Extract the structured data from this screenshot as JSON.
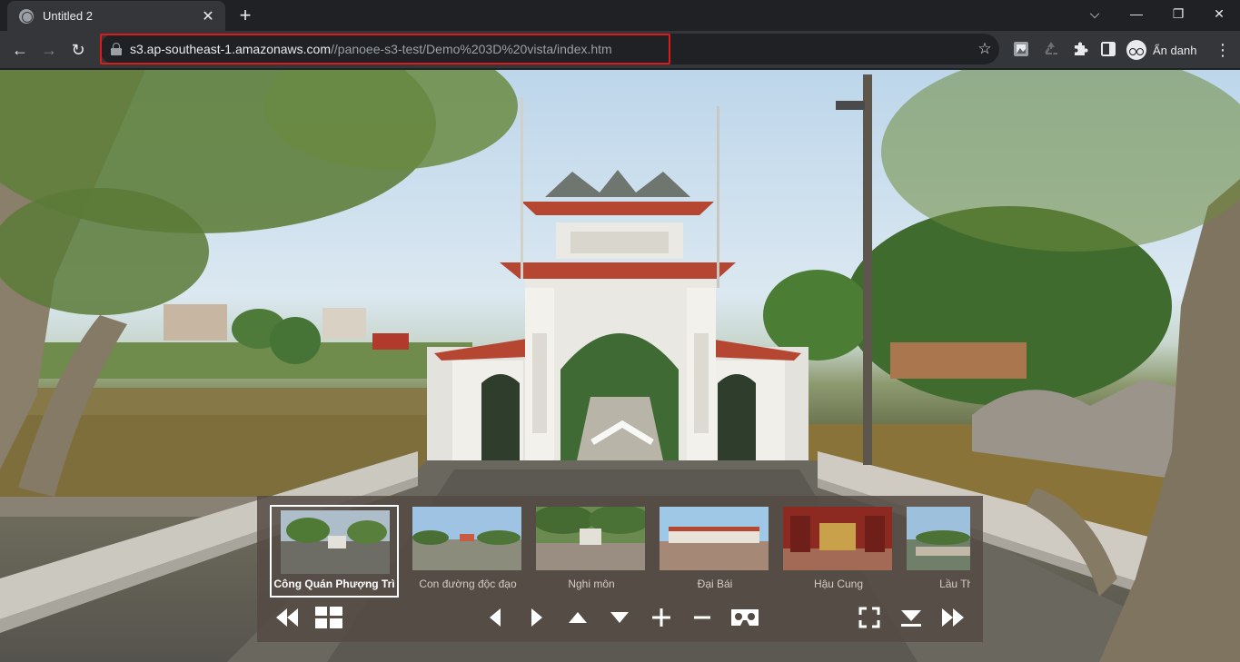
{
  "browser": {
    "tab_title": "Untitled 2",
    "tab_close_symbol": "✕",
    "new_tab_symbol": "+",
    "window_controls": {
      "collapse": "⌵",
      "minimize": "—",
      "restore": "❐",
      "close": "✕"
    },
    "nav": {
      "back": "←",
      "forward": "→",
      "reload": "↻"
    },
    "url_host": "s3.ap-southeast-1.amazonaws.com",
    "url_path": "//panoee-s3-test/Demo%203D%20vista/index.htm",
    "bookmark_star": "☆",
    "profile_label": "Ẩn danh",
    "menu_symbol": "⋮",
    "accent_highlight": "#e0191b"
  },
  "tour": {
    "scenes": [
      {
        "label": "Công Quán Phượng Trì",
        "active": true
      },
      {
        "label": "Con đường độc đạo",
        "active": false
      },
      {
        "label": "Nghi môn",
        "active": false
      },
      {
        "label": "Đại Bái",
        "active": false
      },
      {
        "label": "Hậu Cung",
        "active": false
      },
      {
        "label": "Lầu Thuỷ",
        "active": false
      }
    ],
    "controls": [
      "rewind",
      "grid",
      "pan-left",
      "pan-right",
      "pan-up",
      "pan-down",
      "zoom-in",
      "zoom-out",
      "vr",
      "fullscreen",
      "hide-panel",
      "fast-forward"
    ],
    "panel_color": "#544a44"
  }
}
